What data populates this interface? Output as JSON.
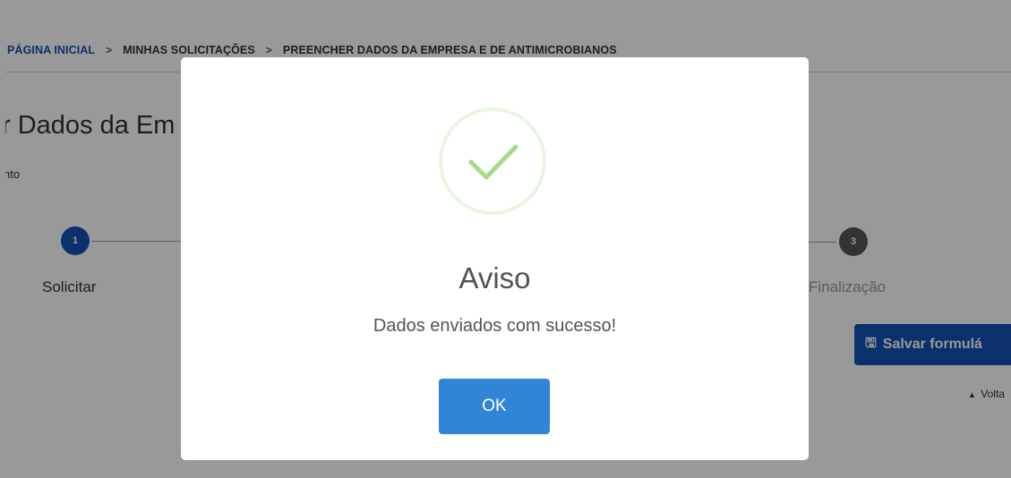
{
  "breadcrumb": {
    "home": "PÁGINA INICIAL",
    "sep1": ">",
    "item2": "MINHAS SOLICITAÇÕES",
    "sep2": ">",
    "item3": "PREENCHER DADOS  DA EMPRESA E DE  ANTIMICROBIANOS"
  },
  "page": {
    "title": "r Dados  da Em",
    "subtext": "nto"
  },
  "steps": [
    {
      "number": "1",
      "label": "Solicitar"
    },
    {
      "number": "3",
      "label": "Finalização"
    }
  ],
  "actions": {
    "save_label": "Salvar formulá",
    "save_icon": "floppy-disk-icon",
    "back_label": "Volta",
    "back_icon": "caret-up-icon"
  },
  "modal": {
    "icon": "success-check-icon",
    "title": "Aviso",
    "message": "Dados enviados com sucesso!",
    "ok_label": "OK"
  },
  "colors": {
    "primary": "#1351b4",
    "ok_button": "#3085d6",
    "check": "#a5dc86",
    "overlay": "rgba(0,0,0,0.4)"
  }
}
